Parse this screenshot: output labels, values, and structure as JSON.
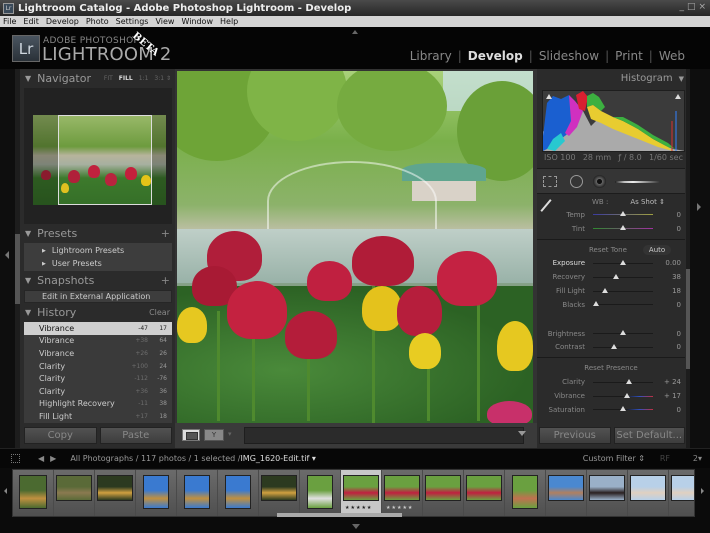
{
  "window": {
    "title": "Lightroom Catalog - Adobe Photoshop Lightroom - Develop",
    "controls": [
      "_",
      "□",
      "×"
    ]
  },
  "menu": [
    "File",
    "Edit",
    "Develop",
    "Photo",
    "Settings",
    "View",
    "Window",
    "Help"
  ],
  "identity": {
    "logo_mark": "Lr",
    "line1": "ADOBE PHOTOSHOP",
    "line2": "LIGHTROOM 2",
    "badge": "BETA"
  },
  "modules": [
    {
      "label": "Library",
      "active": false
    },
    {
      "label": "Develop",
      "active": true
    },
    {
      "label": "Slideshow",
      "active": false
    },
    {
      "label": "Print",
      "active": false
    },
    {
      "label": "Web",
      "active": false
    }
  ],
  "left_panel": {
    "navigator": {
      "title": "Navigator",
      "zoom_options": [
        "FIT",
        "FILL",
        "1:1",
        "3:1 ⇕"
      ],
      "selected_zoom": "FILL"
    },
    "presets": {
      "title": "Presets",
      "add": "+",
      "items": [
        "Lightroom Presets",
        "User Presets"
      ]
    },
    "snapshots": {
      "title": "Snapshots",
      "add": "+",
      "items": [
        "Edit in External Application"
      ]
    },
    "history": {
      "title": "History",
      "clear_label": "Clear",
      "items": [
        {
          "name": "Vibrance",
          "from": "-47",
          "to": "17",
          "selected": true
        },
        {
          "name": "Vibrance",
          "from": "+38",
          "to": "64"
        },
        {
          "name": "Vibrance",
          "from": "+26",
          "to": "26"
        },
        {
          "name": "Clarity",
          "from": "+100",
          "to": "24"
        },
        {
          "name": "Clarity",
          "from": "-112",
          "to": "-76"
        },
        {
          "name": "Clarity",
          "from": "+36",
          "to": "36"
        },
        {
          "name": "Highlight Recovery",
          "from": "-11",
          "to": "38"
        },
        {
          "name": "Fill Light",
          "from": "+17",
          "to": "18"
        }
      ]
    },
    "buttons": {
      "copy": "Copy",
      "paste": "Paste"
    }
  },
  "right_panel": {
    "histogram": {
      "title": "Histogram",
      "exif": {
        "iso": "ISO 100",
        "focal": "28 mm",
        "aperture": "ƒ / 8.0",
        "shutter": "1/60 sec"
      }
    },
    "white_balance": {
      "label": "WB :",
      "value": "As Shot ⇕",
      "sliders": [
        {
          "label": "Temp",
          "value": "0",
          "position": 0.5
        },
        {
          "label": "Tint",
          "value": "0",
          "position": 0.5
        }
      ]
    },
    "tone": {
      "reset_label": "Reset Tone",
      "auto_label": "Auto",
      "sliders": [
        {
          "label": "Exposure",
          "value": "0.00",
          "position": 0.5
        },
        {
          "label": "Recovery",
          "value": "38",
          "position": 0.38
        },
        {
          "label": "Fill Light",
          "value": "18",
          "position": 0.2
        },
        {
          "label": "Blacks",
          "value": "0",
          "position": 0.05
        },
        {
          "label": "Brightness",
          "value": "0",
          "position": 0.5
        },
        {
          "label": "Contrast",
          "value": "0",
          "position": 0.35
        }
      ]
    },
    "presence": {
      "reset_label": "Reset Presence",
      "sliders": [
        {
          "label": "Clarity",
          "value": "+ 24",
          "position": 0.6
        },
        {
          "label": "Vibrance",
          "value": "+ 17",
          "position": 0.56
        },
        {
          "label": "Saturation",
          "value": "0",
          "position": 0.5
        }
      ]
    },
    "buttons": {
      "previous": "Previous",
      "set_default": "Set Default..."
    }
  },
  "filmstrip_bar": {
    "source": "All Photographs / 117 photos / 1 selected / ",
    "filename": "IMG_1620-Edit.tif ▾",
    "filter": "Custom Filter ⇕",
    "rf": "RF",
    "secondary": "2▾"
  },
  "filmstrip": {
    "thumbnails": [
      {
        "subject": "fountain",
        "stars": ""
      },
      {
        "subject": "pond",
        "stars": ""
      },
      {
        "subject": "fountain-gold",
        "stars": ""
      },
      {
        "subject": "fountain-sky",
        "stars": ""
      },
      {
        "subject": "fountain-sky",
        "stars": ""
      },
      {
        "subject": "fountain-sky",
        "stars": ""
      },
      {
        "subject": "fountain-gold",
        "stars": ""
      },
      {
        "subject": "monument",
        "stars": ""
      },
      {
        "subject": "tulips",
        "stars": "★★★★★",
        "selected": true
      },
      {
        "subject": "tulips",
        "stars": "★★★★★"
      },
      {
        "subject": "tulips",
        "stars": ""
      },
      {
        "subject": "tulips",
        "stars": ""
      },
      {
        "subject": "garden",
        "stars": ""
      },
      {
        "subject": "plaza",
        "stars": ""
      },
      {
        "subject": "portrait",
        "stars": ""
      },
      {
        "subject": "fountain-pale",
        "stars": ""
      },
      {
        "subject": "fountain-pale",
        "stars": ""
      }
    ]
  }
}
